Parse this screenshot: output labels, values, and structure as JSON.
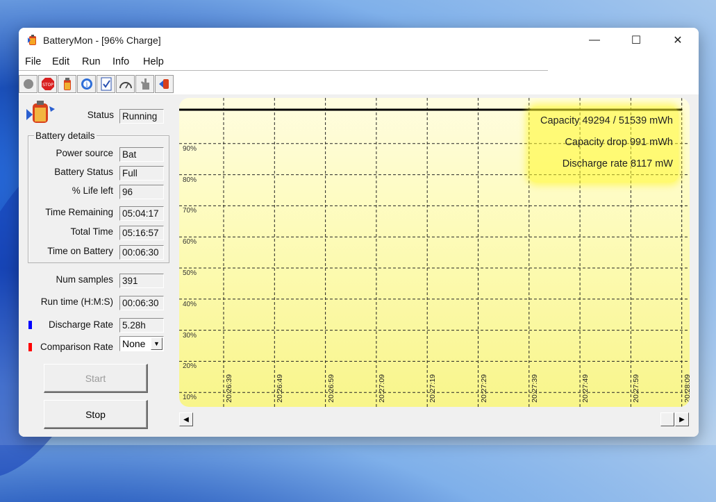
{
  "window": {
    "title": "BatteryMon - [96% Charge]",
    "controls": {
      "minimize": "—",
      "maximize": "☐",
      "close": "✕"
    }
  },
  "menu": [
    {
      "label": "File"
    },
    {
      "label": "Edit"
    },
    {
      "label": "Run"
    },
    {
      "label": "Info"
    },
    {
      "label": "Help"
    }
  ],
  "toolbar": [
    "record-icon",
    "stop-icon",
    "battery-icon",
    "info-globe-icon",
    "checklist-icon",
    "gauge-icon",
    "hand-icon",
    "exit-icon"
  ],
  "status": {
    "label": "Status",
    "value": "Running"
  },
  "battery_details": {
    "title": "Battery details",
    "rows": [
      {
        "label": "Power source",
        "value": "Bat"
      },
      {
        "label": "Battery Status",
        "value": "Full"
      },
      {
        "label": "% Life left",
        "value": "96"
      },
      {
        "label": "Time Remaining",
        "value": "05:04:17"
      },
      {
        "label": "Total Time",
        "value": "05:16:57"
      },
      {
        "label": "Time on Battery",
        "value": "00:06:30"
      }
    ]
  },
  "stats": {
    "num_samples": {
      "label": "Num samples",
      "value": "391"
    },
    "run_time": {
      "label": "Run time (H:M:S)",
      "value": "00:06:30"
    },
    "discharge_rate": {
      "label": "Discharge Rate",
      "value": "5.28h",
      "color": "#0000ff"
    },
    "comparison_rate": {
      "label": "Comparison Rate",
      "value": "None",
      "color": "#ff0000"
    }
  },
  "buttons": {
    "start": "Start",
    "stop": "Stop"
  },
  "chart_data": {
    "type": "line",
    "ylabels": [
      "90%",
      "80%",
      "70%",
      "60%",
      "50%",
      "40%",
      "30%",
      "20%",
      "10%"
    ],
    "xlabels": [
      "20:26:39",
      "20:26:49",
      "20:26:59",
      "20:27:09",
      "20:27:19",
      "20:27:29",
      "20:27:39",
      "20:27:49",
      "20:27:59",
      "20:28:09"
    ],
    "series": [
      {
        "values": [
          100,
          100,
          100,
          100,
          100,
          100,
          100,
          100,
          100,
          100
        ]
      }
    ],
    "ylim": [
      0,
      100
    ],
    "grid": true,
    "line_color": "#000000",
    "background_color": "#fdfbb0"
  },
  "overlay": {
    "capacity": "Capacity 49294 / 51539 mWh",
    "capacity_drop": "Capacity drop 991 mWh",
    "discharge_rate": "Discharge rate 8117 mW"
  }
}
